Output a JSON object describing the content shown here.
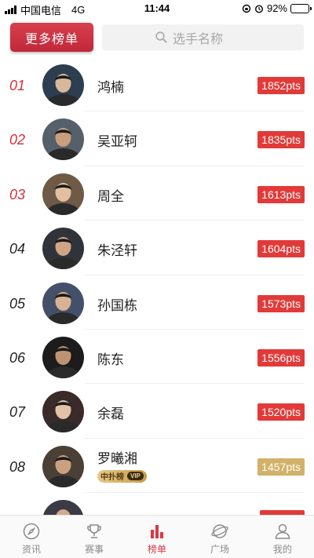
{
  "status_bar": {
    "carrier": "中国电信",
    "network": "4G",
    "time": "11:44",
    "battery": "92%",
    "battery_level": 0.92
  },
  "header": {
    "more_button": "更多榜单",
    "search_placeholder": "选手名称"
  },
  "colors": {
    "accent": "#d62f3b",
    "badge_red": "#e23a38",
    "badge_gold": "#d2b16a"
  },
  "rankings": [
    {
      "rank": "01",
      "name": "鸿楠",
      "points": "1852pts"
    },
    {
      "rank": "02",
      "name": "吴亚轲",
      "points": "1835pts"
    },
    {
      "rank": "03",
      "name": "周全",
      "points": "1613pts"
    },
    {
      "rank": "04",
      "name": "朱泾轩",
      "points": "1604pts"
    },
    {
      "rank": "05",
      "name": "孙国栋",
      "points": "1573pts"
    },
    {
      "rank": "06",
      "name": "陈东",
      "points": "1556pts"
    },
    {
      "rank": "07",
      "name": "余磊",
      "points": "1520pts"
    },
    {
      "rank": "08",
      "name": "罗曦湘",
      "points": "1457pts",
      "vip_badge": "中扑榜",
      "vip_tag": "VIP"
    }
  ],
  "tabs": [
    {
      "label": "资讯",
      "icon": "compass-icon"
    },
    {
      "label": "赛事",
      "icon": "trophy-icon"
    },
    {
      "label": "榜单",
      "icon": "bar-chart-icon"
    },
    {
      "label": "广场",
      "icon": "planet-icon"
    },
    {
      "label": "我的",
      "icon": "user-icon"
    }
  ]
}
